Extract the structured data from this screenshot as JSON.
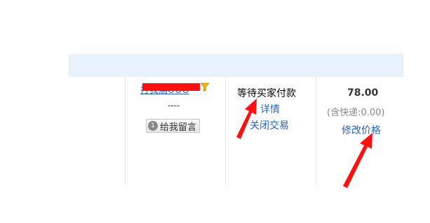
{
  "order_row": {
    "buyer": {
      "name": "打我酒OOO",
      "name_suffix": "----",
      "message_button_label": "给我留言",
      "message_count": "1"
    },
    "status": {
      "text": "等待买家付款",
      "detail_link": "详情",
      "close_link": "关闭交易"
    },
    "price": {
      "amount": "78.00",
      "shipping": "(含快递:0.00)",
      "modify_link": "修改价格"
    }
  },
  "colors": {
    "header_bg": "#e8f2fd",
    "link": "#2d61b9",
    "annotation": "#ff1010"
  },
  "icons": [
    "filter-icon",
    "message-count-icon",
    "arrow-annotation"
  ]
}
